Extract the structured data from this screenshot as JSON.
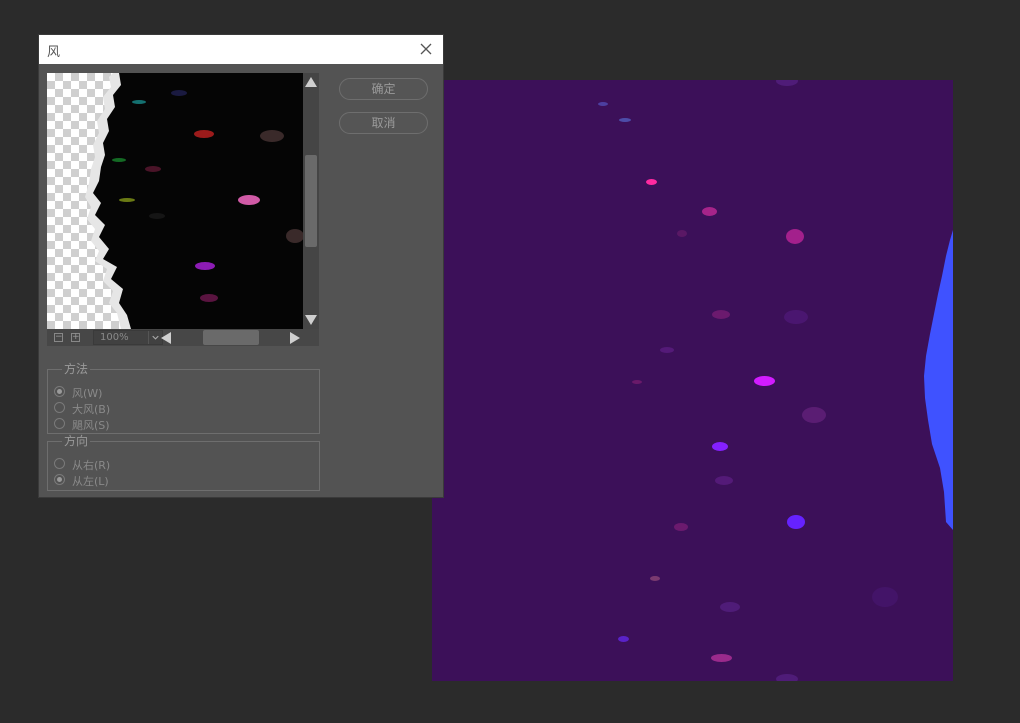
{
  "dialog": {
    "title": "风",
    "ok_label": "确定",
    "cancel_label": "取消"
  },
  "preview": {
    "zoom": "100%"
  },
  "method": {
    "legend": "方法",
    "options": [
      {
        "label": "风(W)",
        "selected": true
      },
      {
        "label": "大风(B)",
        "selected": false
      },
      {
        "label": "飓风(S)",
        "selected": false
      }
    ]
  },
  "direction": {
    "legend": "方向",
    "options": [
      {
        "label": "从右(R)",
        "selected": false
      },
      {
        "label": "从左(L)",
        "selected": true
      }
    ]
  },
  "colors": {
    "document_background": "#3c1059",
    "workspace": "#2b2b2b",
    "dialog_panel": "#535353",
    "wind_streak": "#3f52ff"
  }
}
